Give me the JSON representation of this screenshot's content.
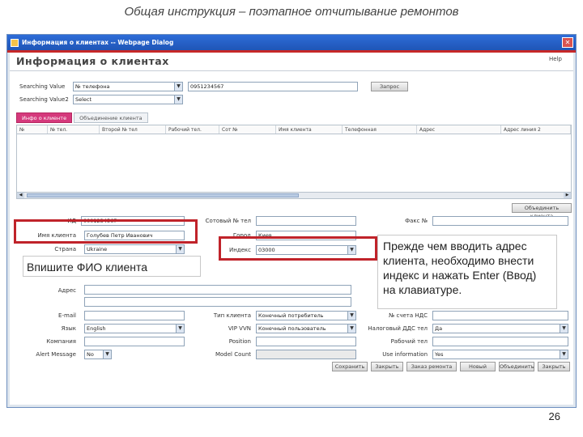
{
  "slide": {
    "title": "Общая инструкция – поэтапное отчитывание ремонтов",
    "page_number": "26"
  },
  "window": {
    "title": "Информация о клиентах -- Webpage Dialog",
    "close_icon": "close-icon"
  },
  "header": {
    "title": "Информация о клиентах",
    "help": "Help"
  },
  "search": {
    "label1": "Searching Value",
    "select1": "№ телефона",
    "value1": "0951234567",
    "label2": "Searching Value2",
    "select2": "Select",
    "search_button": "Запрос"
  },
  "tabs": [
    {
      "label": "Инфо о клиенте",
      "active": true
    },
    {
      "label": "Объединение клиента",
      "active": false
    }
  ],
  "grid": {
    "columns": [
      "№",
      "№ тел.",
      "Второй № тел",
      "Рабочий тел.",
      "Сот №",
      "Имя клиента",
      "Телефонная",
      "Адрес",
      "Адрес линия 2"
    ]
  },
  "form": {
    "merge_button": "Объединить клиента",
    "labels": {
      "id": "ИД",
      "name": "Имя клиента",
      "country": "Страна",
      "address": "Адрес",
      "email": "E-mail",
      "language": "Язык",
      "company": "Компания",
      "alert": "Alert Message",
      "mobile": "Сотовый № тел",
      "city": "Город",
      "postcode": "Индекс",
      "customer_type": "Тип клиента",
      "vip": "VIP VVN",
      "position": "Position",
      "model": "Model Count",
      "fax": "Факс №",
      "vat": "№ счета НДС",
      "partner": "Налоговый ДДС тел",
      "contact_tel": "Рабочий тел",
      "use_info": "Use information"
    },
    "values": {
      "id": "0001234567",
      "name": "Голубев Петр Иванович",
      "country": "Ukraine",
      "city": "Киев",
      "postcode": "03000",
      "customer_type": "Конечный потребитель",
      "vip": "Конечный пользователь",
      "language": "English",
      "alert": "No",
      "partner": "Да",
      "use_info": "Yes"
    },
    "bottom_buttons": [
      "Сохранить",
      "Закрыть",
      "Заказ ремонта",
      "Новый",
      "Объединить",
      "Закрыть"
    ]
  },
  "callouts": {
    "fio": "Впишите ФИО клиента",
    "index": "Прежде чем вводить адрес клиента, необходимо внести индекс и нажать Enter (Ввод) на клавиатуре."
  },
  "colors": {
    "titlebar": "#2E6DD8",
    "highlight": "#C0232A",
    "active_tab": "#D5397C"
  }
}
